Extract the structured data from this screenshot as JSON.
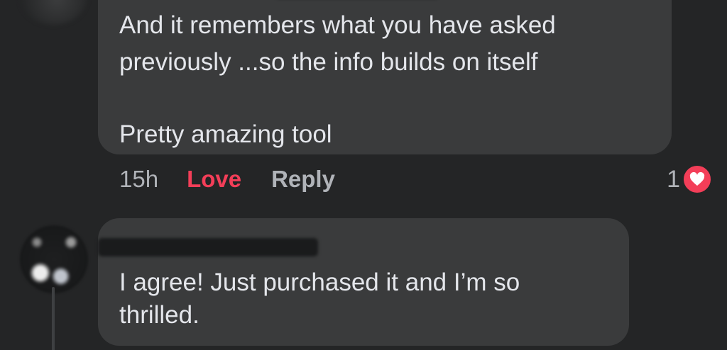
{
  "thread": {
    "first_comment": {
      "lines": [
        "And it remembers what you have asked",
        "previously ...so the info builds on itself",
        "Pretty amazing tool"
      ],
      "time": "15h",
      "love_label": "Love",
      "reply_label": "Reply",
      "reaction_count": "1",
      "reaction_icon": "heart-icon",
      "love_color": "#f33e58"
    },
    "second_comment": {
      "lines": [
        "I agree! Just purchased it and I’m so",
        "thrilled."
      ]
    }
  },
  "colors": {
    "background": "#242526",
    "bubble": "#3a3b3c",
    "text": "#e4e6eb",
    "secondary_text": "#b0b3b8"
  }
}
